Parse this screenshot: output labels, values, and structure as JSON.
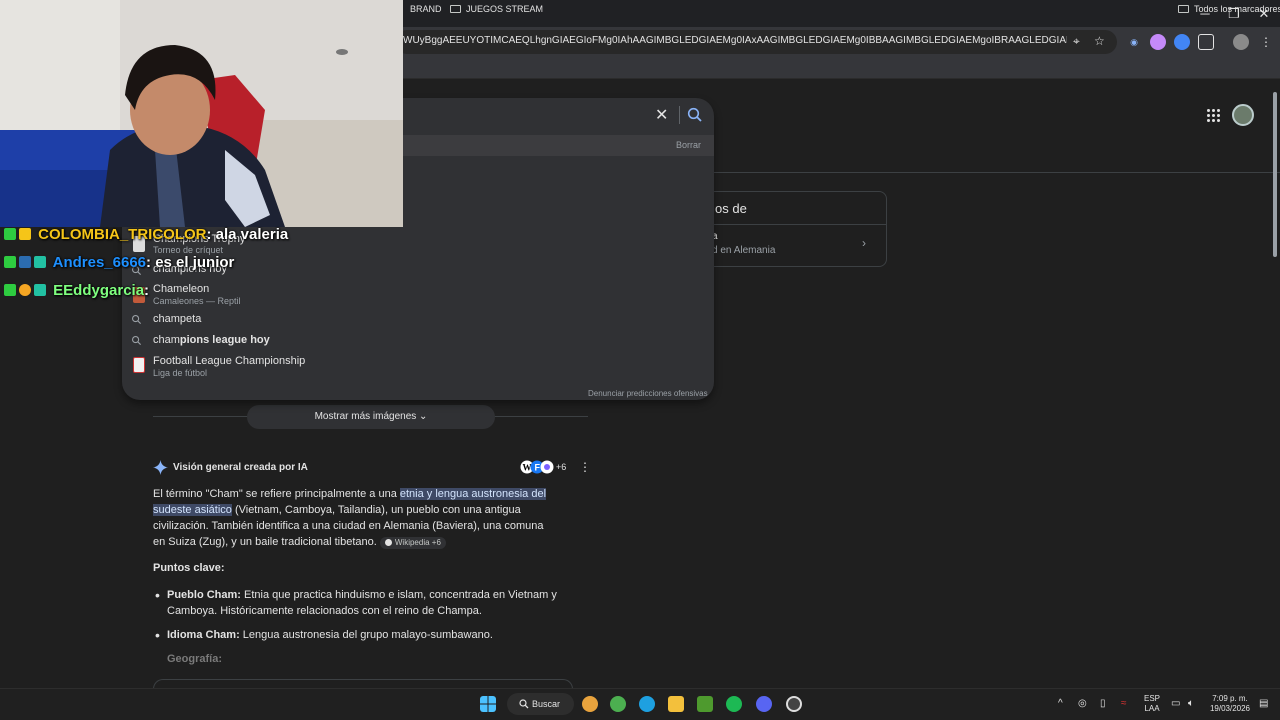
{
  "browser": {
    "url": "WUyBggAEEUYOTIMCAEQLhgnGIAEGIoFMg0IAhAAGIMBGLEDGIAEMg0IAxAAGIMBGLEDGIAEMg0IBBAAGIMBGLEDGIAEMgoIBRAAGLEDGIAEMgoIBhAuGLEDGI...",
    "bookmarks": [
      {
        "label": "BRAND"
      },
      {
        "label": "JUEGOS STREAM"
      }
    ],
    "all_bookmarks": "Todos los marcadores"
  },
  "search_dropdown": {
    "clear_label": "Borrar",
    "suggestions": [
      {
        "text": "Champions Trophy",
        "sub": "Torneo de críquet"
      },
      {
        "text": "champions hoy",
        "sub": ""
      },
      {
        "text": "Chameleon",
        "sub": "Camaleones — Reptil"
      },
      {
        "prefix": "champeta",
        "bold": "",
        "sub": ""
      },
      {
        "prefix": "cham",
        "bold": "pions league hoy",
        "sub": ""
      },
      {
        "text": "Football League Championship",
        "sub": "Liga de fútbol"
      }
    ],
    "report": "Denunciar predicciones ofensivas"
  },
  "knowledge_panel": {
    "title": "os de",
    "line1": "a",
    "line2": "d en Alemania"
  },
  "results": {
    "more_images": "Mostrar más imágenes",
    "ai_title": "Visión general creada por IA",
    "source_count": "+6",
    "para_pre": "El término \"Cham\" se refiere principalmente a una ",
    "para_highlight": "etnia y lengua austronesia del sudeste asiático",
    "para_post": " (Vietnam, Camboya, Tailandia), un pueblo con una antigua civilización. También identifica a una ciudad en Alemania (Baviera), una comuna en Suiza (Zug), y un baile tradicional tibetano.",
    "wiki_chip": "Wikipedia +6",
    "key_points_title": "Puntos clave:",
    "bullets": [
      {
        "label": "Pueblo Cham:",
        "text": " Etnia que practica hinduismo e islam, concentrada en Vietnam y Camboya. Históricamente relacionados con el reino de Champa."
      },
      {
        "label": "Idioma Cham:",
        "text": " Lengua austronesia del grupo malayo-sumbawano."
      },
      {
        "label": "Geografía:",
        "text": ""
      }
    ]
  },
  "chat": [
    {
      "user": "COLOMBIA_TRICOLOR",
      "message": ": ala valeria",
      "color": "#f5c518"
    },
    {
      "user": "Andres_6666",
      "message": ": es el junior",
      "color": "#1e90ff"
    },
    {
      "user": "EEddygarcia",
      "message": ":",
      "color": "#7fff7f"
    }
  ],
  "taskbar": {
    "search_label": "Buscar",
    "lang": "ESP",
    "lang_sub": "LAA",
    "time": "7:09 p. m.",
    "date": "19/03/2026"
  }
}
